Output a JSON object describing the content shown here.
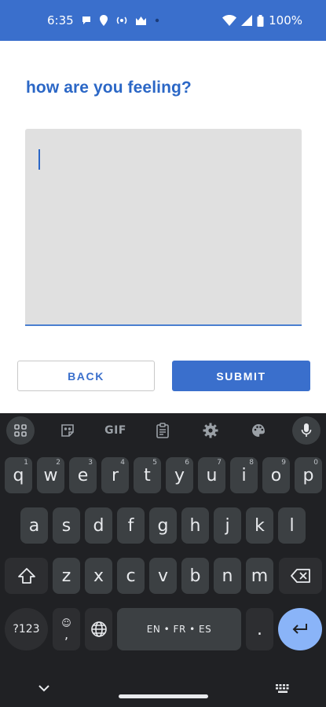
{
  "status_bar": {
    "time": "6:35",
    "battery": "100%",
    "icons": [
      "chat-bubble-icon",
      "location-icon",
      "broadcast-icon",
      "crown-icon",
      "dot-icon",
      "wifi-icon",
      "signal-icon",
      "battery-icon"
    ]
  },
  "form": {
    "question": "how are you feeling?",
    "answer_value": "",
    "back_label": "BACK",
    "submit_label": "SUBMIT"
  },
  "colors": {
    "accent": "#3a6fcc",
    "title": "#2b67c6",
    "input_bg": "#e0e0e0",
    "keyboard_bg": "#202124",
    "key_bg": "#3c4043",
    "enter_key": "#8ab4f8"
  },
  "keyboard": {
    "toolbar": {
      "apps": "grid-icon",
      "sticker": "sticker-icon",
      "gif": "GIF",
      "clipboard": "clipboard-icon",
      "settings": "gear-icon",
      "theme": "palette-icon",
      "voice": "microphone-icon"
    },
    "row1": [
      {
        "k": "q",
        "h": "1"
      },
      {
        "k": "w",
        "h": "2"
      },
      {
        "k": "e",
        "h": "3"
      },
      {
        "k": "r",
        "h": "4"
      },
      {
        "k": "t",
        "h": "5"
      },
      {
        "k": "y",
        "h": "6"
      },
      {
        "k": "u",
        "h": "7"
      },
      {
        "k": "i",
        "h": "8"
      },
      {
        "k": "o",
        "h": "9"
      },
      {
        "k": "p",
        "h": "0"
      }
    ],
    "row2": [
      "a",
      "s",
      "d",
      "f",
      "g",
      "h",
      "j",
      "k",
      "l"
    ],
    "row3": [
      "z",
      "x",
      "c",
      "v",
      "b",
      "n",
      "m"
    ],
    "symbols_label": "?123",
    "emoji_comma": ",",
    "space_label": "EN • FR • ES",
    "period": "."
  }
}
